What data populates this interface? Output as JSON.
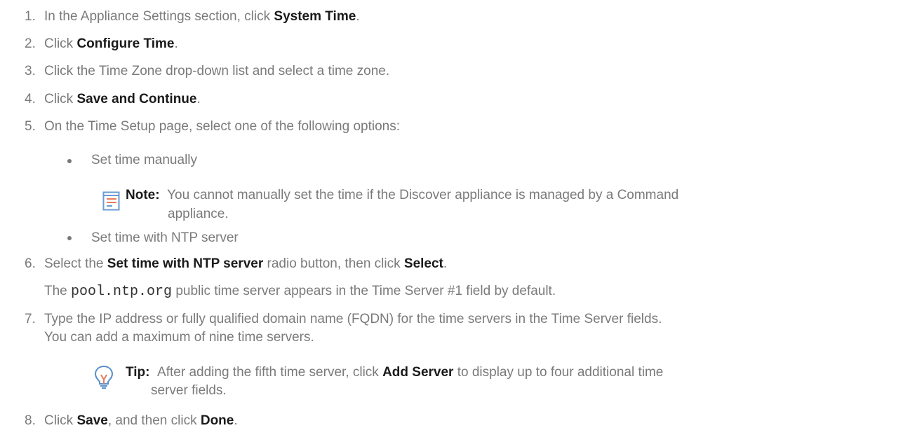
{
  "steps": [
    {
      "num": "1.",
      "pre": "In the Appliance Settings section, click ",
      "b1": "System Time",
      "post": "."
    },
    {
      "num": "2.",
      "pre": "Click ",
      "b1": "Configure Time",
      "post": "."
    },
    {
      "num": "3.",
      "text": "Click the Time Zone drop-down list and select a time zone."
    },
    {
      "num": "4.",
      "pre": "Click ",
      "b1": "Save and Continue",
      "post": "."
    },
    {
      "num": "5.",
      "text": "On the Time Setup page, select one of the following options:"
    },
    {
      "num": "6.",
      "pre": "Select the ",
      "b1": "Set time with NTP server",
      "mid": " radio button, then click ",
      "b2": "Select",
      "post": "."
    },
    {
      "num": "7.",
      "line1": "Type the IP address or fully qualified domain name (FQDN) for the time servers in the Time Server fields.",
      "line2": "You can add a maximum of nine time servers."
    },
    {
      "num": "8.",
      "pre": "Click ",
      "b1": "Save",
      "mid": ", and then click ",
      "b2": "Done",
      "post": "."
    }
  ],
  "bullets": [
    "Set time manually",
    "Set time with NTP server"
  ],
  "note": {
    "label": "Note:",
    "line1": "You cannot manually set the time if the Discover appliance is managed by a Command",
    "line2": "appliance."
  },
  "step6_detail": {
    "pre": "The ",
    "code": "pool.ntp.org",
    "post": " public time server appears in the Time Server #1 field by default."
  },
  "tip": {
    "label": "Tip:",
    "pre": "After adding the fifth time server, click ",
    "b1": "Add Server",
    "post": " to display up to four additional time",
    "line2": "server fields."
  }
}
